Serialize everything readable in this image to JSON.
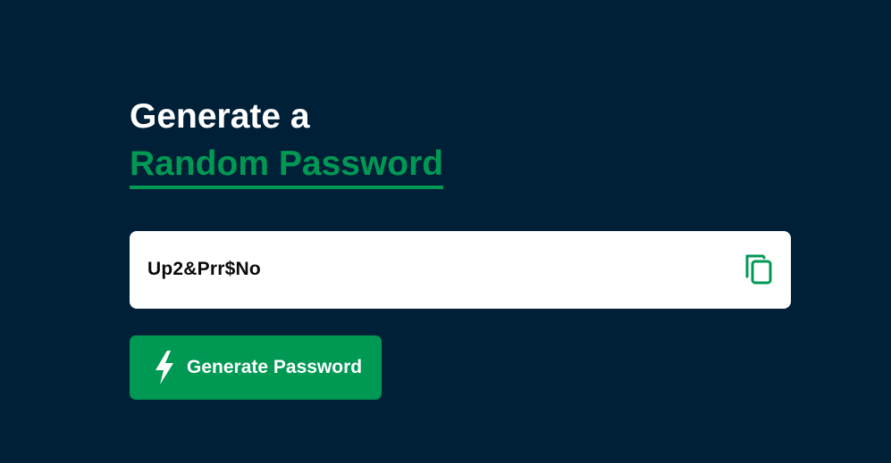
{
  "heading": {
    "line1": "Generate a",
    "line2": "Random Password"
  },
  "password": {
    "value": "Up2&Prr$No",
    "copy_icon": "copy-icon"
  },
  "generate_button": {
    "label": "Generate Password",
    "icon": "lightning-bolt-icon"
  },
  "colors": {
    "background": "#002038",
    "accent": "#009954",
    "field_bg": "#ffffff",
    "text_dark": "#0a0a0a",
    "text_light": "#ffffff"
  }
}
